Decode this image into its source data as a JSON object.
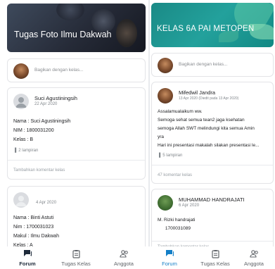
{
  "left": {
    "banner_title": "Tugas Foto Ilmu Dakwah",
    "share_placeholder": "Bagikan dengan kelas...",
    "posts": [
      {
        "author": "Suci Agustiningsih",
        "date": "22 Apr 2020",
        "lines": [
          "Nama : Suci Agustiningsih",
          "NIM : 1800031200",
          "Kelas : B"
        ],
        "attachments": "2 lampiran",
        "comment_prompt": "Tambahkan komentar kelas"
      },
      {
        "author": "",
        "date": "4 Apr 2020",
        "lines": [
          "Nama : Binti Astuti",
          "Nim   : 1700031023",
          "Makul : Ilmu Dakwah",
          "Kelas :  A"
        ]
      }
    ]
  },
  "right": {
    "banner_title": "KELAS 6A PAI METOPEN",
    "share_placeholder": "Bagikan dengan kelas...",
    "posts": [
      {
        "author": "Mifedwil Jandra",
        "date": "13 Apr 2020 (Diedit pada 13 Apr 2020)",
        "lines": [
          "Assalamualaikum ww.",
          "Semoga sehat semua tean2 jaga ksehatan",
          "semoga Allah SWT melindungi kita semua Amin",
          "yra",
          "Hari ini presentasi makalah silakan presentasi le..."
        ],
        "attachments": "5 lampiran",
        "comments": "47 komentar kelas"
      },
      {
        "author": "MUHAMMAD HANDRAJATI",
        "date": "6 Apr 2020",
        "lines": [
          "M. Rizki handrajati",
          "      1700031089"
        ],
        "comment_prompt": "Tambahkan komentar kelas"
      }
    ]
  },
  "nav": {
    "forum": "Forum",
    "tugas": "Tugas Kelas",
    "anggota": "Anggota"
  },
  "colors": {
    "accent_blue": "#137fc7",
    "banner_teal": "#1a8a86",
    "banner_dark": "#262b38"
  }
}
